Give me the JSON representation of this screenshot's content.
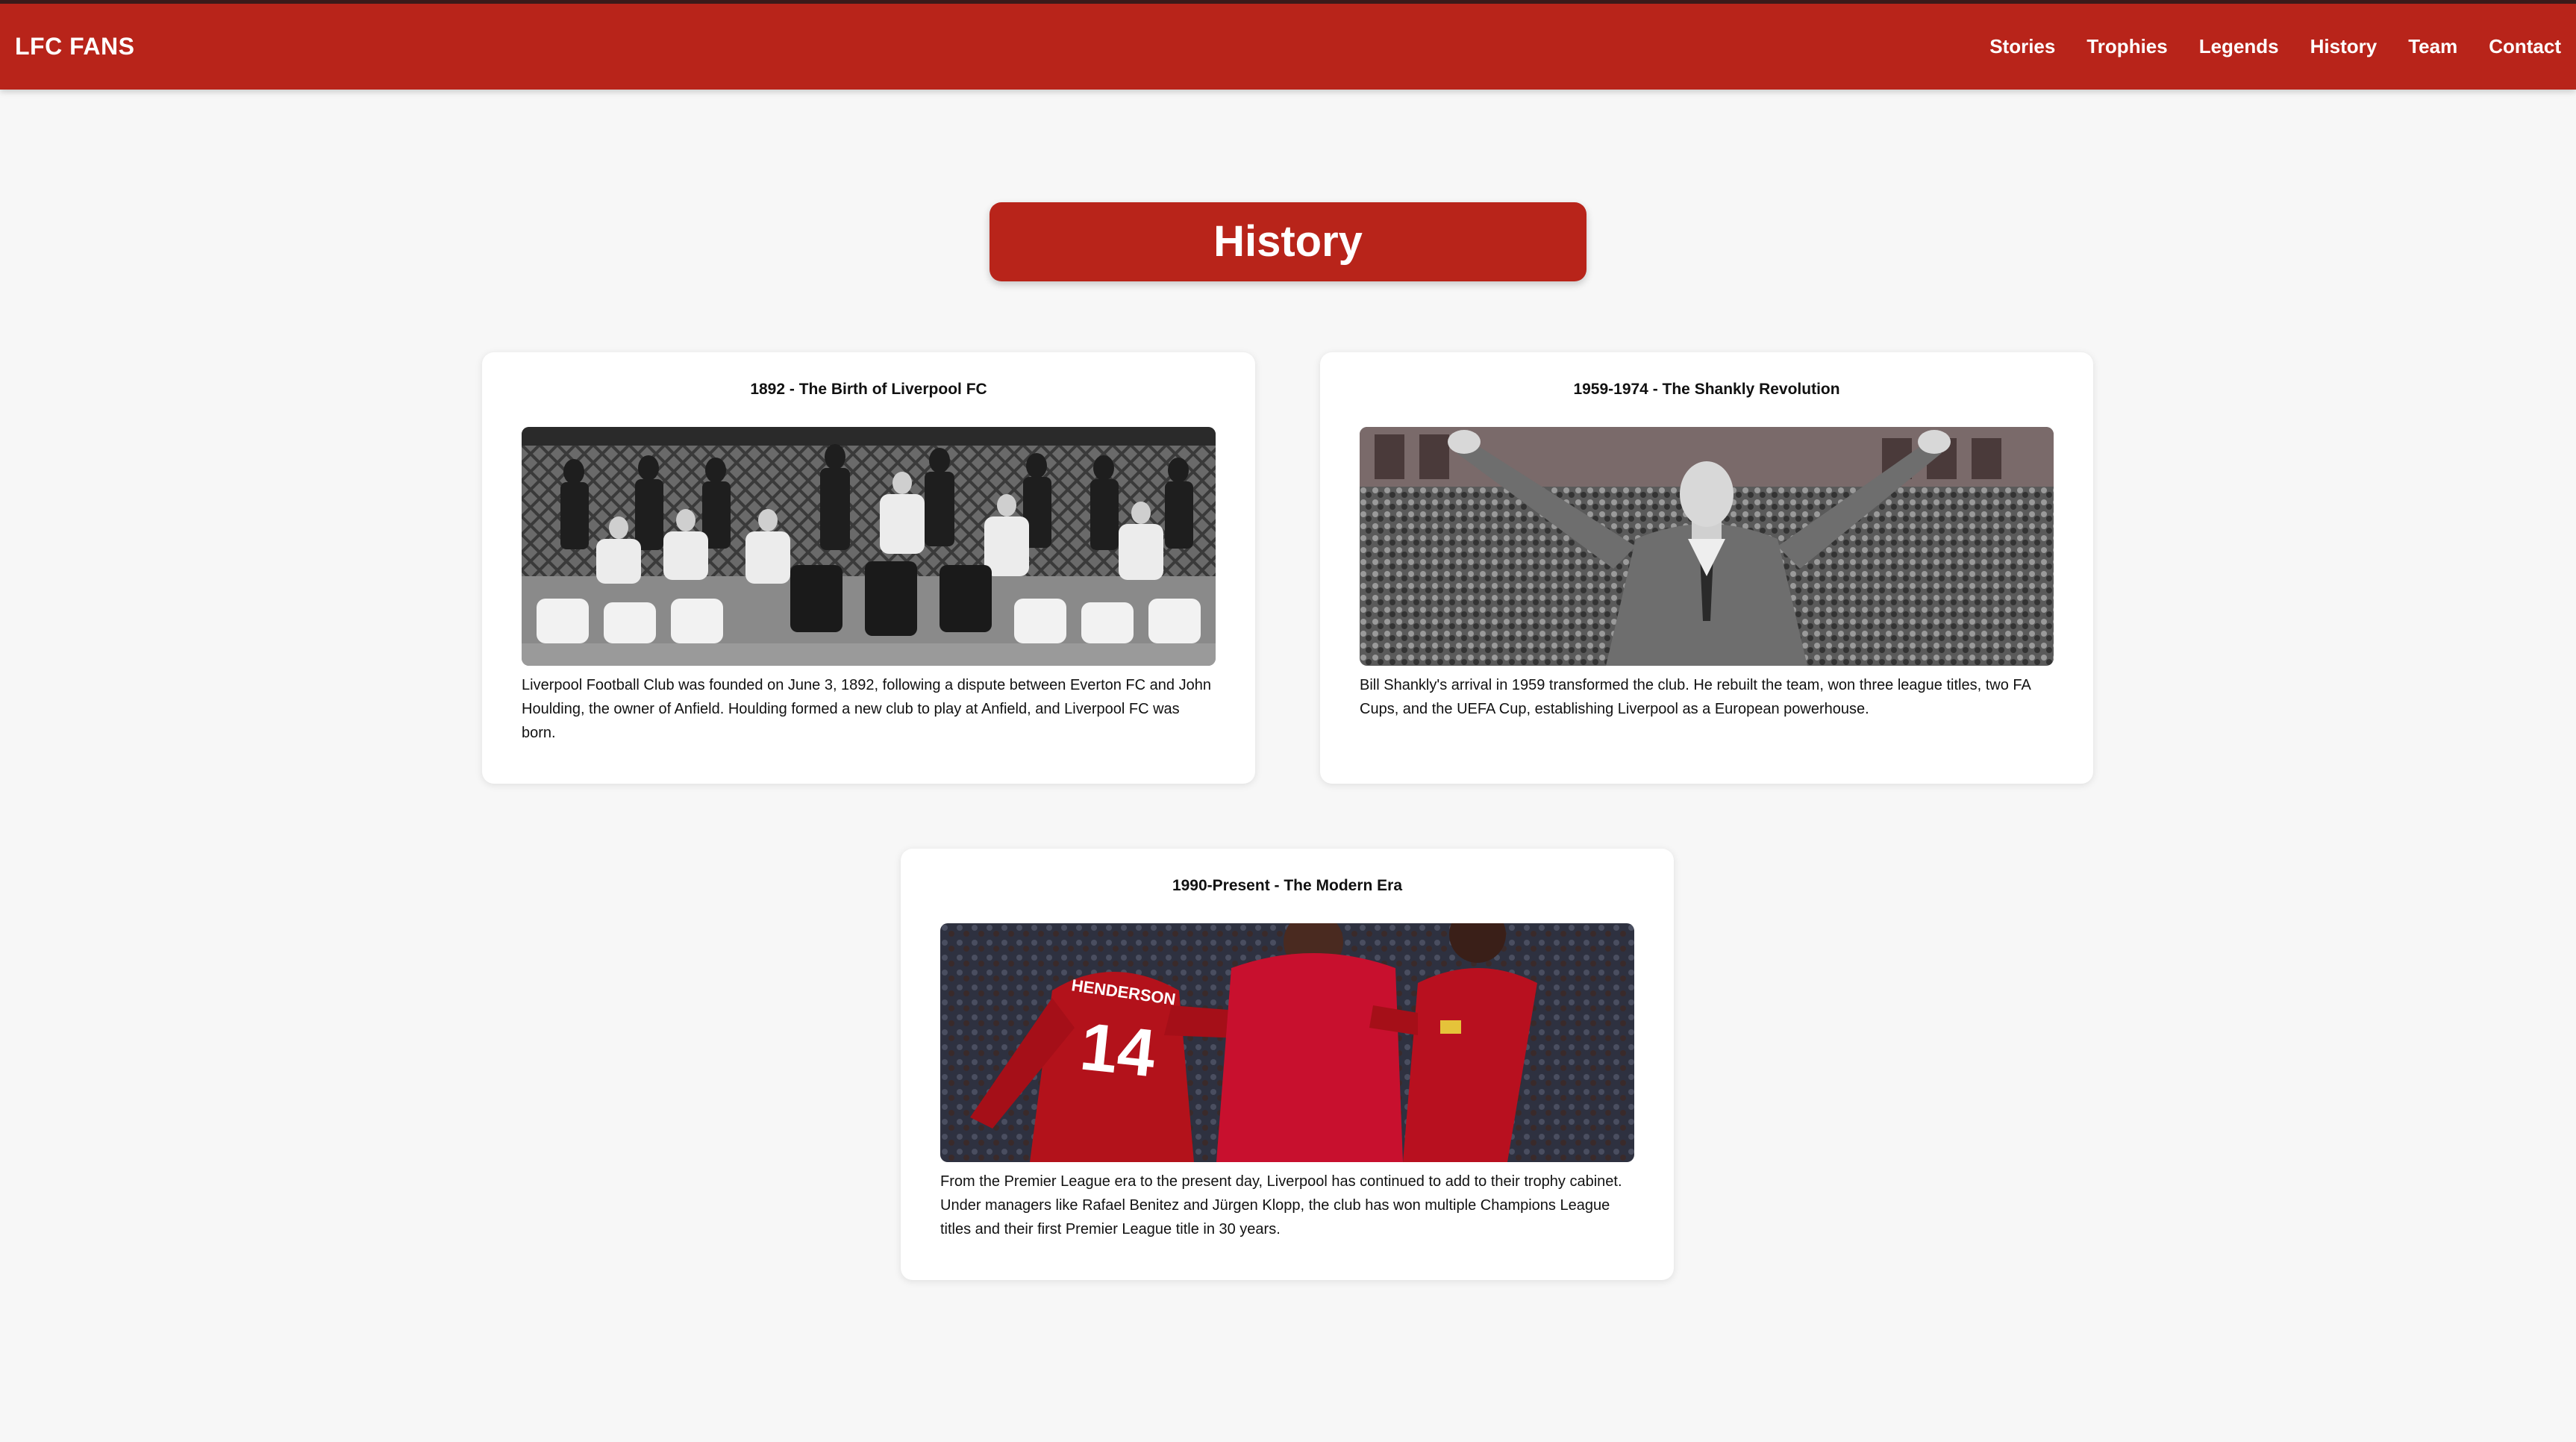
{
  "brand": "LFC FANS",
  "nav": {
    "items": [
      "Stories",
      "Trophies",
      "Legends",
      "History",
      "Team",
      "Contact"
    ]
  },
  "page_title": "History",
  "cards": [
    {
      "title": "1892 - The Birth of Liverpool FC",
      "image": "team-photo-1892",
      "text": "Liverpool Football Club was founded on June 3, 1892, following a dispute between Everton FC and John Houlding, the owner of Anfield. Houlding formed a new club to play at Anfield, and Liverpool FC was born."
    },
    {
      "title": "1959-1974 - The Shankly Revolution",
      "image": "shankly-crowd-photo",
      "text": "Bill Shankly's arrival in 1959 transformed the club. He rebuilt the team, won three league titles, two FA Cups, and the UEFA Cup, establishing Liverpool as a European powerhouse."
    },
    {
      "title": "1990-Present - The Modern Era",
      "image": "modern-players-photo",
      "text": "From the Premier League era to the present day, Liverpool has continued to add to their trophy cabinet. Under managers like Rafael Benitez and Jürgen Klopp, the club has won multiple Champions League titles and their first Premier League title in 30 years.",
      "jersey_name": "HENDERSON",
      "jersey_number": "14"
    }
  ],
  "colors": {
    "primary": "#b8241a",
    "background": "#f7f7f7",
    "card": "#ffffff"
  }
}
